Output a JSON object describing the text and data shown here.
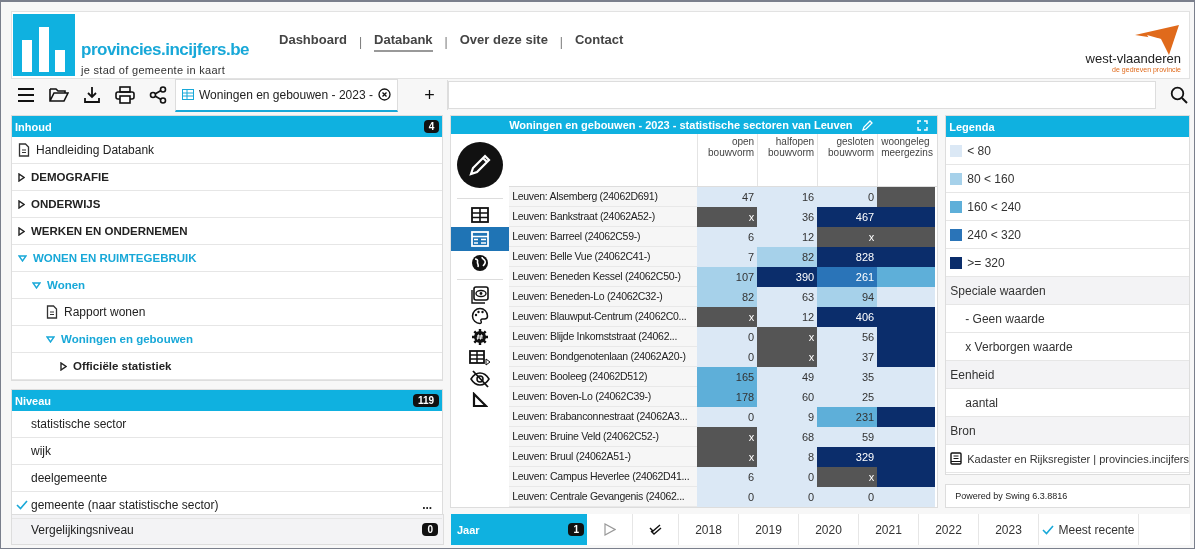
{
  "header": {
    "site_name": "provincies.incijfers.be",
    "tagline": "je stad of gemeente in kaart",
    "nav": [
      {
        "label": "Dashboard",
        "selected": false
      },
      {
        "label": "Databank",
        "selected": true
      },
      {
        "label": "Over deze site",
        "selected": false
      },
      {
        "label": "Contact",
        "selected": false
      }
    ],
    "separator": "|",
    "partner": {
      "name": "west-vlaanderen",
      "slogan": "de gedreven provincie"
    }
  },
  "toolbar": {
    "tab": {
      "label": "Woningen en gebouwen - 2023 -",
      "selected": true
    },
    "add": "+"
  },
  "contents": {
    "title": "Inhoud",
    "count": "4",
    "items": [
      {
        "label": "Handleiding Databank",
        "kind": "document"
      },
      {
        "label": "DEMOGRAFIE",
        "kind": "folder",
        "expanded": false
      },
      {
        "label": "ONDERWIJS",
        "kind": "folder",
        "expanded": false
      },
      {
        "label": "WERKEN EN ONDERNEMEN",
        "kind": "folder",
        "expanded": false
      },
      {
        "label": "WONEN EN RUIMTEGEBRUIK",
        "kind": "folder",
        "expanded": true,
        "children": [
          {
            "label": "Wonen",
            "kind": "folder",
            "expanded": true,
            "children": [
              {
                "label": "Rapport wonen",
                "kind": "document"
              },
              {
                "label": "Woningen en gebouwen",
                "kind": "folder",
                "expanded": true,
                "children": [
                  {
                    "label": "Officiële statistiek",
                    "kind": "folder",
                    "expanded": false
                  }
                ]
              }
            ]
          }
        ]
      }
    ]
  },
  "level": {
    "title": "Niveau",
    "count": "119",
    "more": "...",
    "items": [
      {
        "label": "statistische sector",
        "selected": false
      },
      {
        "label": "wijk",
        "selected": false
      },
      {
        "label": "deelgemeente",
        "selected": false
      },
      {
        "label": "gemeente (naar statistische sector)",
        "selected": true
      }
    ]
  },
  "comparison": {
    "label": "Vergelijkingsniveau",
    "count": "0"
  },
  "table_panel": {
    "title": "Woningen en gebouwen - 2023 - statistische sectoren van Leuven",
    "view_tools": [
      {
        "kind": "table",
        "selected": false
      },
      {
        "kind": "table-detail",
        "selected": true
      },
      {
        "kind": "globe",
        "selected": false
      }
    ],
    "option_tools": [
      {
        "kind": "frame-eye"
      },
      {
        "kind": "palette"
      },
      {
        "kind": "hash-gear"
      },
      {
        "kind": "table-arrow"
      },
      {
        "kind": "eye-slash"
      },
      {
        "kind": "ruler"
      }
    ],
    "columns": [
      {
        "label": "open bouwvorm"
      },
      {
        "label": "halfopen bouwvorm"
      },
      {
        "label": "gesloten bouwvorm"
      },
      {
        "label": "woongeleg meergezins"
      }
    ],
    "rows": [
      {
        "name": "Leuven: Alsemberg (24062D691)",
        "cells": [
          {
            "value": "47",
            "color": "#dbe8f5"
          },
          {
            "value": "16",
            "color": "#dbe8f5"
          },
          {
            "value": "0",
            "color": "#dbe8f5"
          },
          {
            "color": "#555555"
          }
        ]
      },
      {
        "name": "Leuven: Bankstraat (24062A52-)",
        "cells": [
          {
            "value": "x",
            "color": "#555555"
          },
          {
            "value": "36",
            "color": "#dbe8f5"
          },
          {
            "value": "467",
            "color": "#0b2d6b"
          },
          {
            "color": "#0b2d6b"
          }
        ]
      },
      {
        "name": "Leuven: Barreel (24062C59-)",
        "cells": [
          {
            "value": "6",
            "color": "#dbe8f5"
          },
          {
            "value": "12",
            "color": "#dbe8f5"
          },
          {
            "value": "x",
            "color": "#555555"
          },
          {
            "color": "#555555"
          }
        ]
      },
      {
        "name": "Leuven: Belle Vue (24062C41-)",
        "cells": [
          {
            "value": "7",
            "color": "#dbe8f5"
          },
          {
            "value": "82",
            "color": "#a6d1ea"
          },
          {
            "value": "828",
            "color": "#0b2d6b"
          },
          {
            "color": "#0b2d6b"
          }
        ]
      },
      {
        "name": "Leuven: Beneden Kessel (24062C50-)",
        "cells": [
          {
            "value": "107",
            "color": "#a6d1ea"
          },
          {
            "value": "390",
            "color": "#0b2d6b"
          },
          {
            "value": "261",
            "color": "#2a74b8"
          },
          {
            "color": "#5eafd9"
          }
        ]
      },
      {
        "name": "Leuven: Beneden-Lo (24062C32-)",
        "cells": [
          {
            "value": "82",
            "color": "#a6d1ea"
          },
          {
            "value": "63",
            "color": "#dbe8f5"
          },
          {
            "value": "94",
            "color": "#a6d1ea"
          },
          {
            "color": "#dbe8f5"
          }
        ]
      },
      {
        "name": "Leuven: Blauwput-Centrum (24062C0...",
        "cells": [
          {
            "value": "x",
            "color": "#555555"
          },
          {
            "value": "12",
            "color": "#dbe8f5"
          },
          {
            "value": "406",
            "color": "#0b2d6b"
          },
          {
            "color": "#0b2d6b"
          }
        ]
      },
      {
        "name": "Leuven: Blijde Inkomststraat (24062...",
        "cells": [
          {
            "value": "0",
            "color": "#dbe8f5"
          },
          {
            "value": "x",
            "color": "#555555"
          },
          {
            "value": "56",
            "color": "#dbe8f5"
          },
          {
            "color": "#0b2d6b"
          }
        ]
      },
      {
        "name": "Leuven: Bondgenotenlaan (24062A20-)",
        "cells": [
          {
            "value": "0",
            "color": "#dbe8f5"
          },
          {
            "value": "x",
            "color": "#555555"
          },
          {
            "value": "37",
            "color": "#dbe8f5"
          },
          {
            "color": "#0b2d6b"
          }
        ]
      },
      {
        "name": "Leuven: Booleeg (24062D512)",
        "cells": [
          {
            "value": "165",
            "color": "#5eafd9"
          },
          {
            "value": "49",
            "color": "#dbe8f5"
          },
          {
            "value": "35",
            "color": "#dbe8f5"
          },
          {
            "color": "#dbe8f5"
          }
        ]
      },
      {
        "name": "Leuven: Boven-Lo (24062C39-)",
        "cells": [
          {
            "value": "178",
            "color": "#5eafd9"
          },
          {
            "value": "60",
            "color": "#dbe8f5"
          },
          {
            "value": "25",
            "color": "#dbe8f5"
          },
          {
            "color": "#dbe8f5"
          }
        ]
      },
      {
        "name": "Leuven: Brabanconnestraat (24062A3...",
        "cells": [
          {
            "value": "0",
            "color": "#dbe8f5"
          },
          {
            "value": "9",
            "color": "#dbe8f5"
          },
          {
            "value": "231",
            "color": "#5eafd9"
          },
          {
            "color": "#0b2d6b"
          }
        ]
      },
      {
        "name": "Leuven: Bruine Veld (24062C52-)",
        "cells": [
          {
            "value": "x",
            "color": "#555555"
          },
          {
            "value": "68",
            "color": "#dbe8f5"
          },
          {
            "value": "59",
            "color": "#dbe8f5"
          },
          {
            "color": "#dbe8f5"
          }
        ]
      },
      {
        "name": "Leuven: Bruul (24062A51-)",
        "cells": [
          {
            "value": "x",
            "color": "#555555"
          },
          {
            "value": "8",
            "color": "#dbe8f5"
          },
          {
            "value": "329",
            "color": "#0b2d6b"
          },
          {
            "color": "#0b2d6b"
          }
        ]
      },
      {
        "name": "Leuven: Campus Heverlee (24062D41...",
        "cells": [
          {
            "value": "6",
            "color": "#dbe8f5"
          },
          {
            "value": "0",
            "color": "#dbe8f5"
          },
          {
            "value": "x",
            "color": "#555555"
          },
          {
            "color": "#0b2d6b"
          }
        ]
      },
      {
        "name": "Leuven: Centrale Gevangenis (24062...",
        "cells": [
          {
            "value": "0",
            "color": "#dbe8f5"
          },
          {
            "value": "0",
            "color": "#dbe8f5"
          },
          {
            "value": "0",
            "color": "#dbe8f5"
          },
          {
            "color": "#dbe8f5"
          }
        ]
      }
    ]
  },
  "legend": {
    "title": "Legenda",
    "items": [
      {
        "kind": "swatch",
        "label": "< 80",
        "color": "#dbe8f5"
      },
      {
        "kind": "swatch",
        "label": "80 < 160",
        "color": "#a6d1ea"
      },
      {
        "kind": "swatch",
        "label": "160 < 240",
        "color": "#5eafd9"
      },
      {
        "kind": "swatch",
        "label": "240 < 320",
        "color": "#2a74b8"
      },
      {
        "kind": "swatch",
        "label": ">= 320",
        "color": "#0b2d6b"
      },
      {
        "kind": "section",
        "label": "Speciale waarden"
      },
      {
        "kind": "entry",
        "label": "- Geen waarde"
      },
      {
        "kind": "entry",
        "label": "x Verborgen waarde"
      },
      {
        "kind": "section",
        "label": "Eenheid"
      },
      {
        "kind": "entry",
        "label": "aantal"
      },
      {
        "kind": "section",
        "label": "Bron"
      },
      {
        "kind": "source",
        "label": "Kadaster en Rijksregister | provincies.incijfers"
      }
    ],
    "powered_by": "Powered by Swing 6.3.8816"
  },
  "period": {
    "title": "Jaar",
    "count": "1",
    "years": [
      {
        "label": "2018",
        "selected": false
      },
      {
        "label": "2019",
        "selected": false
      },
      {
        "label": "2020",
        "selected": false
      },
      {
        "label": "2021",
        "selected": false
      },
      {
        "label": "2022",
        "selected": false
      },
      {
        "label": "2023",
        "selected": false
      }
    ],
    "latest": {
      "label": "Meest recente",
      "checked": true
    }
  }
}
